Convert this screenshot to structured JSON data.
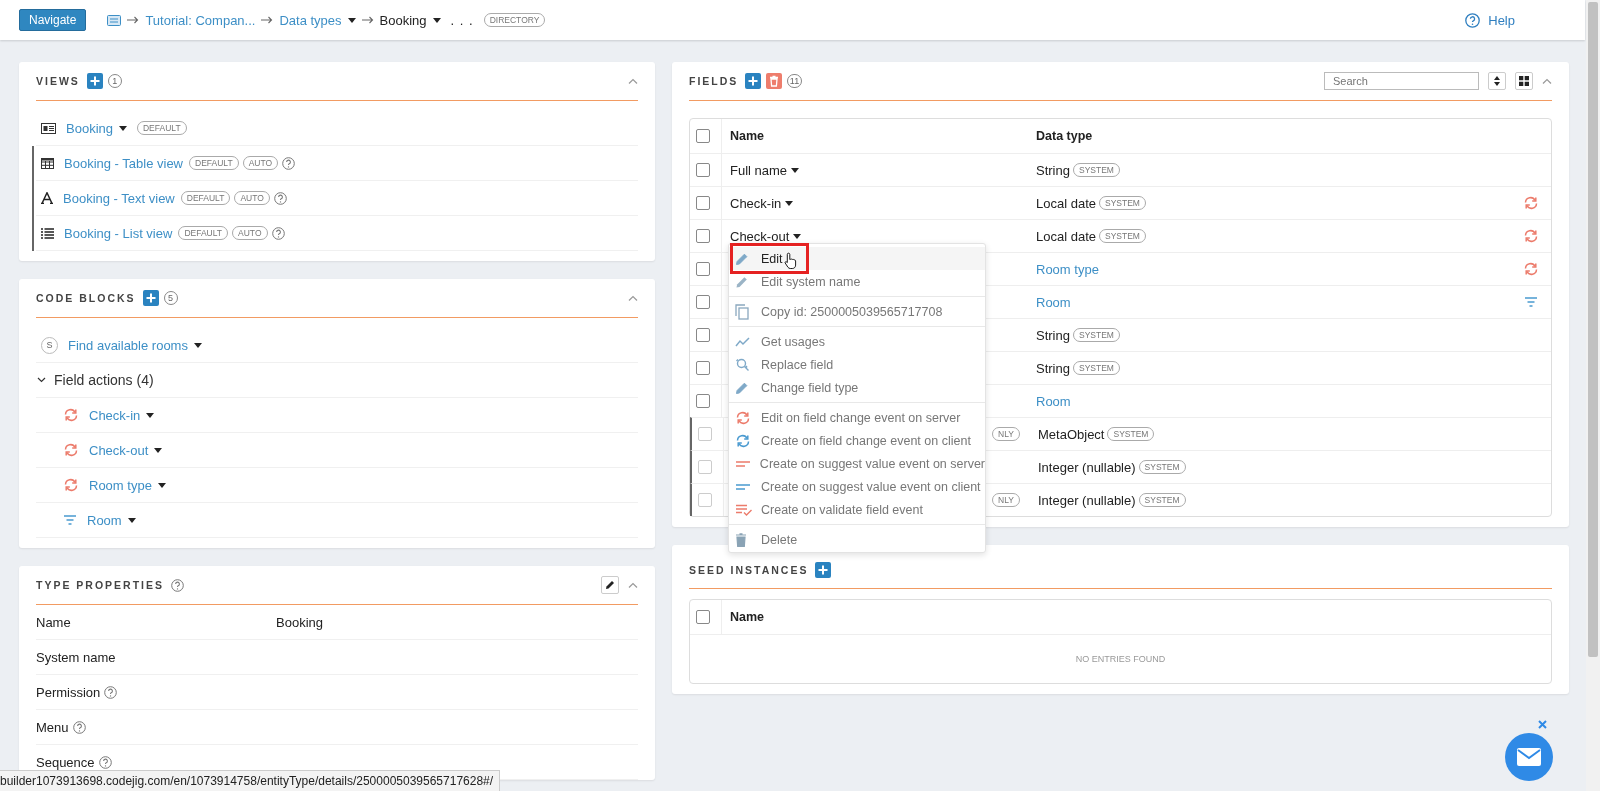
{
  "header": {
    "navigate_button": "Navigate",
    "breadcrumb": [
      {
        "label": "Tutorial: Compan...",
        "dropdown": false,
        "current": false
      },
      {
        "label": "Data types",
        "dropdown": true,
        "current": false
      },
      {
        "label": "Booking",
        "dropdown": true,
        "current": true
      }
    ],
    "ellipsis": ". . .",
    "badge": "DIRECTORY",
    "help": "Help"
  },
  "views": {
    "title": "VIEWS",
    "count": "1",
    "items": [
      {
        "kind": "form",
        "label": "Booking",
        "dropdown": true,
        "badges": [
          "DEFAULT"
        ],
        "help": false,
        "children": [
          {
            "kind": "table",
            "label": "Booking - Table view",
            "dropdown": false,
            "badges": [
              "DEFAULT",
              "AUTO"
            ],
            "help": true
          },
          {
            "kind": "text",
            "label": "Booking - Text view",
            "dropdown": false,
            "badges": [
              "DEFAULT",
              "AUTO"
            ],
            "help": true
          },
          {
            "kind": "list",
            "label": "Booking - List view",
            "dropdown": false,
            "badges": [
              "DEFAULT",
              "AUTO"
            ],
            "help": true
          }
        ]
      }
    ]
  },
  "code_blocks": {
    "title": "CODE BLOCKS",
    "count": "5",
    "items": [
      {
        "kind": "server",
        "badge": "S",
        "label": "Find available rooms"
      },
      {
        "kind": "group",
        "label": "Field actions (4)",
        "expanded": true,
        "children": [
          {
            "kind": "sync",
            "label": "Check-in"
          },
          {
            "kind": "sync",
            "label": "Check-out"
          },
          {
            "kind": "sync",
            "label": "Room type"
          },
          {
            "kind": "filter",
            "label": "Room"
          }
        ]
      }
    ]
  },
  "type_properties": {
    "title": "TYPE PROPERTIES",
    "rows": [
      {
        "label": "Name",
        "help": false,
        "value": "Booking"
      },
      {
        "label": "System name",
        "help": false
      },
      {
        "label": "Permission",
        "help": true
      },
      {
        "label": "Menu",
        "help": true
      },
      {
        "label": "Sequence",
        "help": true
      }
    ]
  },
  "fields": {
    "title": "FIELDS",
    "count": "11",
    "search": {
      "placeholder": "Search"
    },
    "columns": [
      "Name",
      "Data type"
    ],
    "header_checked": false,
    "rows": [
      {
        "kind": "plain",
        "name": "Full name",
        "type": "String",
        "link": false,
        "badge": "SYSTEM",
        "checked": false,
        "disabled": false
      },
      {
        "kind": "sync",
        "name": "Check-in",
        "type": "Local date",
        "link": false,
        "badge": "SYSTEM",
        "checked": false,
        "disabled": false
      },
      {
        "kind": "sync",
        "name": "Check-out",
        "type": "Local date",
        "link": false,
        "badge": "SYSTEM",
        "checked": false,
        "disabled": false
      },
      {
        "kind": "sync",
        "type": "Room type",
        "link": true,
        "checked": false,
        "disabled": false
      },
      {
        "kind": "filter",
        "type": "Room",
        "link": true,
        "checked": false,
        "disabled": false
      },
      {
        "kind": "plain",
        "type": "String",
        "link": false,
        "badge": "SYSTEM",
        "checked": false,
        "disabled": false
      },
      {
        "kind": "plain",
        "type": "String",
        "link": false,
        "badge": "SYSTEM",
        "checked": false,
        "disabled": false
      },
      {
        "kind": "plain",
        "type": "Room",
        "link": true,
        "checked": false,
        "disabled": false
      },
      {
        "kind": "plain",
        "name_badge": "NLY",
        "type": "MetaObject",
        "link": false,
        "badge": "SYSTEM",
        "checked": false,
        "disabled": true
      },
      {
        "kind": "plain",
        "type": "Integer (nullable)",
        "link": false,
        "badge": "SYSTEM",
        "checked": false,
        "disabled": true
      },
      {
        "kind": "plain",
        "name_badge": "NLY",
        "type": "Integer (nullable)",
        "link": false,
        "badge": "SYSTEM",
        "checked": false,
        "disabled": true
      }
    ]
  },
  "context_menu": {
    "groups": [
      {
        "items": [
          {
            "kind": "pencil",
            "label": "Edit",
            "highlighted": true
          },
          {
            "kind": "pencil-grey",
            "label": "Edit system name",
            "highlighted": false
          }
        ]
      },
      {
        "items": [
          {
            "kind": "copy",
            "label": "Copy id: 2500005039565717708",
            "highlighted": false
          }
        ]
      },
      {
        "items": [
          {
            "kind": "usages",
            "label": "Get usages",
            "highlighted": false
          },
          {
            "kind": "replace",
            "label": "Replace field",
            "highlighted": false
          },
          {
            "kind": "pencil",
            "label": "Change field type",
            "highlighted": false
          }
        ]
      },
      {
        "items": [
          {
            "kind": "sync-server",
            "label": "Edit on field change event on server",
            "highlighted": false
          },
          {
            "kind": "sync-client",
            "label": "Create on field change event on client",
            "highlighted": false
          },
          {
            "kind": "suggest-server",
            "label": "Create on suggest value event on server",
            "highlighted": false
          },
          {
            "kind": "suggest-client",
            "label": "Create on suggest value event on client",
            "highlighted": false
          },
          {
            "kind": "validate",
            "label": "Create on validate field event",
            "highlighted": false
          }
        ]
      },
      {
        "items": [
          {
            "kind": "trash",
            "label": "Delete",
            "highlighted": false
          }
        ]
      }
    ]
  },
  "seed_instances": {
    "title": "SEED INSTANCES",
    "columns": [
      "Name"
    ],
    "header_checked": false,
    "empty": "NO ENTRIES FOUND"
  },
  "status_bar": {
    "url": "builder1073913698.codejig.com/en/1073914758/entityType/details/2500005039565717628#/"
  }
}
